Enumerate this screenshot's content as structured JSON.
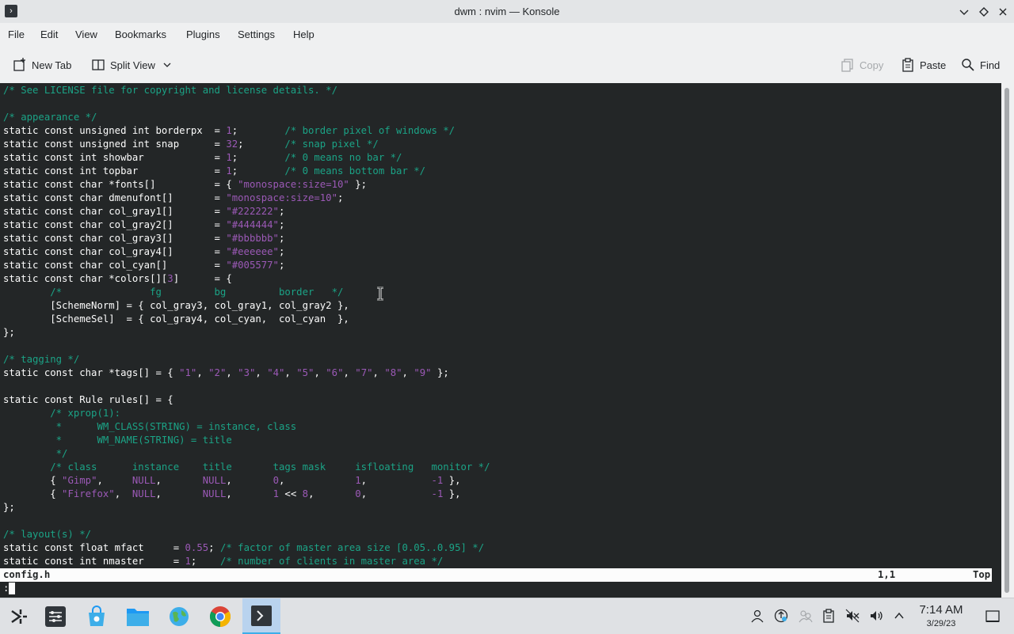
{
  "window": {
    "title": "dwm : nvim — Konsole"
  },
  "menubar": {
    "items": [
      "File",
      "Edit",
      "View",
      "Bookmarks",
      "Plugins",
      "Settings",
      "Help"
    ]
  },
  "toolbar": {
    "new_tab": "New Tab",
    "split_view": "Split View",
    "copy": "Copy",
    "paste": "Paste",
    "find": "Find"
  },
  "editor": {
    "lines": [
      [
        {
          "t": "/* See LICENSE file for copyright and license details. */",
          "c": "c"
        }
      ],
      [],
      [
        {
          "t": "/* appearance */",
          "c": "c"
        }
      ],
      [
        {
          "t": "static const unsigned int borderpx  = "
        },
        {
          "t": "1",
          "c": "n"
        },
        {
          "t": ";        "
        },
        {
          "t": "/* border pixel of windows */",
          "c": "c"
        }
      ],
      [
        {
          "t": "static const unsigned int snap      = "
        },
        {
          "t": "32",
          "c": "n"
        },
        {
          "t": ";       "
        },
        {
          "t": "/* snap pixel */",
          "c": "c"
        }
      ],
      [
        {
          "t": "static const int showbar            = "
        },
        {
          "t": "1",
          "c": "n"
        },
        {
          "t": ";        "
        },
        {
          "t": "/* 0 means no bar */",
          "c": "c"
        }
      ],
      [
        {
          "t": "static const int topbar             = "
        },
        {
          "t": "1",
          "c": "n"
        },
        {
          "t": ";        "
        },
        {
          "t": "/* 0 means bottom bar */",
          "c": "c"
        }
      ],
      [
        {
          "t": "static const char *fonts[]          = { "
        },
        {
          "t": "\"monospace:size=10\"",
          "c": "s"
        },
        {
          "t": " };"
        }
      ],
      [
        {
          "t": "static const char dmenufont[]       = "
        },
        {
          "t": "\"monospace:size=10\"",
          "c": "s"
        },
        {
          "t": ";"
        }
      ],
      [
        {
          "t": "static const char col_gray1[]       = "
        },
        {
          "t": "\"#222222\"",
          "c": "s"
        },
        {
          "t": ";"
        }
      ],
      [
        {
          "t": "static const char col_gray2[]       = "
        },
        {
          "t": "\"#444444\"",
          "c": "s"
        },
        {
          "t": ";"
        }
      ],
      [
        {
          "t": "static const char col_gray3[]       = "
        },
        {
          "t": "\"#bbbbbb\"",
          "c": "s"
        },
        {
          "t": ";"
        }
      ],
      [
        {
          "t": "static const char col_gray4[]       = "
        },
        {
          "t": "\"#eeeeee\"",
          "c": "s"
        },
        {
          "t": ";"
        }
      ],
      [
        {
          "t": "static const char col_cyan[]        = "
        },
        {
          "t": "\"#005577\"",
          "c": "s"
        },
        {
          "t": ";"
        }
      ],
      [
        {
          "t": "static const char *colors[]["
        },
        {
          "t": "3",
          "c": "n"
        },
        {
          "t": "]      = {"
        }
      ],
      [
        {
          "t": "        "
        },
        {
          "t": "/*               fg         bg         border   */",
          "c": "c"
        }
      ],
      [
        {
          "t": "        [SchemeNorm] = { col_gray3, col_gray1, col_gray2 },"
        }
      ],
      [
        {
          "t": "        [SchemeSel]  = { col_gray4, col_cyan,  col_cyan  },"
        }
      ],
      [
        {
          "t": "};"
        }
      ],
      [],
      [
        {
          "t": "/* tagging */",
          "c": "c"
        }
      ],
      [
        {
          "t": "static const char *tags[] = { "
        },
        {
          "t": "\"1\"",
          "c": "s"
        },
        {
          "t": ", "
        },
        {
          "t": "\"2\"",
          "c": "s"
        },
        {
          "t": ", "
        },
        {
          "t": "\"3\"",
          "c": "s"
        },
        {
          "t": ", "
        },
        {
          "t": "\"4\"",
          "c": "s"
        },
        {
          "t": ", "
        },
        {
          "t": "\"5\"",
          "c": "s"
        },
        {
          "t": ", "
        },
        {
          "t": "\"6\"",
          "c": "s"
        },
        {
          "t": ", "
        },
        {
          "t": "\"7\"",
          "c": "s"
        },
        {
          "t": ", "
        },
        {
          "t": "\"8\"",
          "c": "s"
        },
        {
          "t": ", "
        },
        {
          "t": "\"9\"",
          "c": "s"
        },
        {
          "t": " };"
        }
      ],
      [],
      [
        {
          "t": "static const Rule rules[] = {"
        }
      ],
      [
        {
          "t": "        "
        },
        {
          "t": "/* xprop(1):",
          "c": "c"
        }
      ],
      [
        {
          "t": "         *      WM_CLASS(STRING) = instance, class",
          "c": "c"
        }
      ],
      [
        {
          "t": "         *      WM_NAME(STRING) = title",
          "c": "c"
        }
      ],
      [
        {
          "t": "         */",
          "c": "c"
        }
      ],
      [
        {
          "t": "        "
        },
        {
          "t": "/* class      instance    title       tags mask     isfloating   monitor */",
          "c": "c"
        }
      ],
      [
        {
          "t": "        { "
        },
        {
          "t": "\"Gimp\"",
          "c": "s"
        },
        {
          "t": ",     "
        },
        {
          "t": "NULL",
          "c": "n"
        },
        {
          "t": ",       "
        },
        {
          "t": "NULL",
          "c": "n"
        },
        {
          "t": ",       "
        },
        {
          "t": "0",
          "c": "n"
        },
        {
          "t": ",            "
        },
        {
          "t": "1",
          "c": "n"
        },
        {
          "t": ",           "
        },
        {
          "t": "-1",
          "c": "n"
        },
        {
          "t": " },"
        }
      ],
      [
        {
          "t": "        { "
        },
        {
          "t": "\"Firefox\"",
          "c": "s"
        },
        {
          "t": ",  "
        },
        {
          "t": "NULL",
          "c": "n"
        },
        {
          "t": ",       "
        },
        {
          "t": "NULL",
          "c": "n"
        },
        {
          "t": ",       "
        },
        {
          "t": "1",
          "c": "n"
        },
        {
          "t": " << "
        },
        {
          "t": "8",
          "c": "n"
        },
        {
          "t": ",       "
        },
        {
          "t": "0",
          "c": "n"
        },
        {
          "t": ",           "
        },
        {
          "t": "-1",
          "c": "n"
        },
        {
          "t": " },"
        }
      ],
      [
        {
          "t": "};"
        }
      ],
      [],
      [
        {
          "t": "/* layout(s) */",
          "c": "c"
        }
      ],
      [
        {
          "t": "static const float mfact     = "
        },
        {
          "t": "0.55",
          "c": "n"
        },
        {
          "t": "; "
        },
        {
          "t": "/* factor of master area size [0.05..0.95] */",
          "c": "c"
        }
      ],
      [
        {
          "t": "static const int nmaster     = "
        },
        {
          "t": "1",
          "c": "n"
        },
        {
          "t": ";    "
        },
        {
          "t": "/* number of clients in master area */",
          "c": "c"
        }
      ]
    ],
    "status": {
      "filename": "config.h",
      "position": "1,1",
      "scroll": "Top"
    },
    "cmdline": ":"
  },
  "taskbar": {
    "apps": [
      "application-launcher-icon",
      "system-settings-icon",
      "discover-store-icon",
      "file-manager-icon",
      "earth-browser-icon",
      "chrome-icon",
      "konsole-icon"
    ],
    "clock_time": "7:14 AM",
    "clock_date": "3/29/23"
  },
  "colors": {
    "terminal_bg": "#232627",
    "terminal_fg": "#fcfcfc",
    "comment": "#1ba386",
    "literal": "#9b59b6",
    "accent": "#3daee9"
  }
}
